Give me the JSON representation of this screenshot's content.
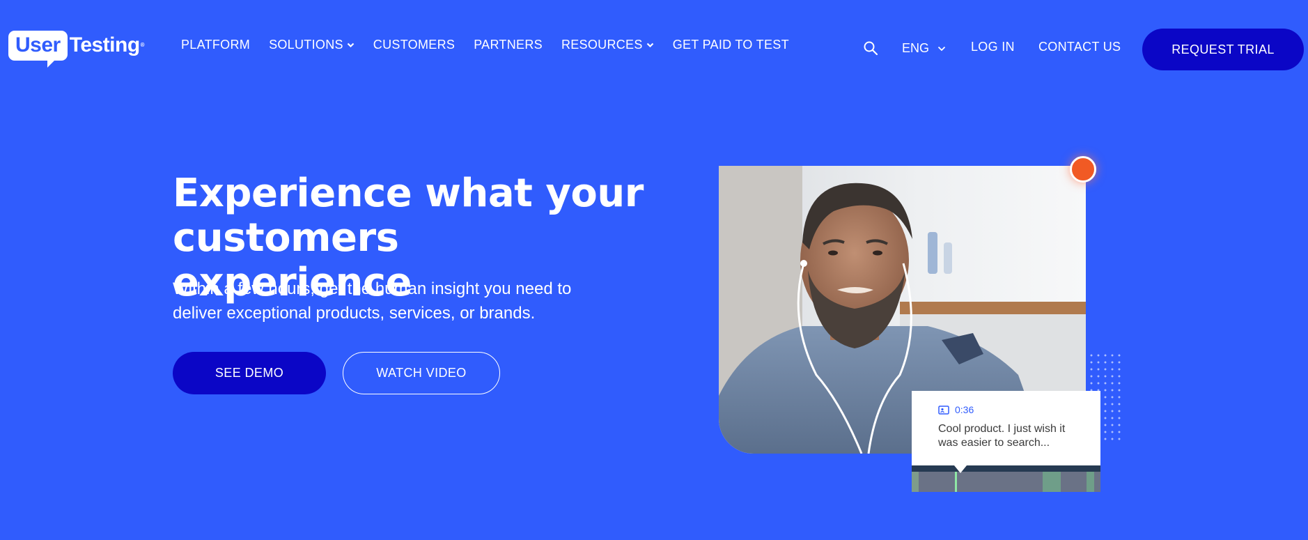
{
  "brand": {
    "logo_user": "User",
    "logo_testing": "Testing",
    "logo_tm": "®"
  },
  "nav": {
    "items": [
      {
        "label": "PLATFORM",
        "dropdown": false
      },
      {
        "label": "SOLUTIONS",
        "dropdown": true
      },
      {
        "label": "CUSTOMERS",
        "dropdown": false
      },
      {
        "label": "PARTNERS",
        "dropdown": false
      },
      {
        "label": "RESOURCES",
        "dropdown": true
      },
      {
        "label": "GET PAID TO TEST",
        "dropdown": false
      }
    ],
    "search_icon": "search-icon",
    "language": "ENG",
    "login": "LOG IN",
    "contact": "CONTACT US",
    "cta": "REQUEST TRIAL"
  },
  "hero": {
    "title_line1": "Experience what your",
    "title_line2": "customers experience",
    "subtitle_line1": "Within a few hours, get the human insight you need to",
    "subtitle_line2": "deliver exceptional products, services, or brands.",
    "primary_button": "SEE DEMO",
    "secondary_button": "WATCH VIDEO"
  },
  "media": {
    "comment_time": "0:36",
    "comment_line1": "Cool product. I just wish it",
    "comment_line2": "was easier to search..."
  },
  "colors": {
    "background": "#305cfd",
    "button_dark": "#0b06c6",
    "record": "#f15a24"
  }
}
